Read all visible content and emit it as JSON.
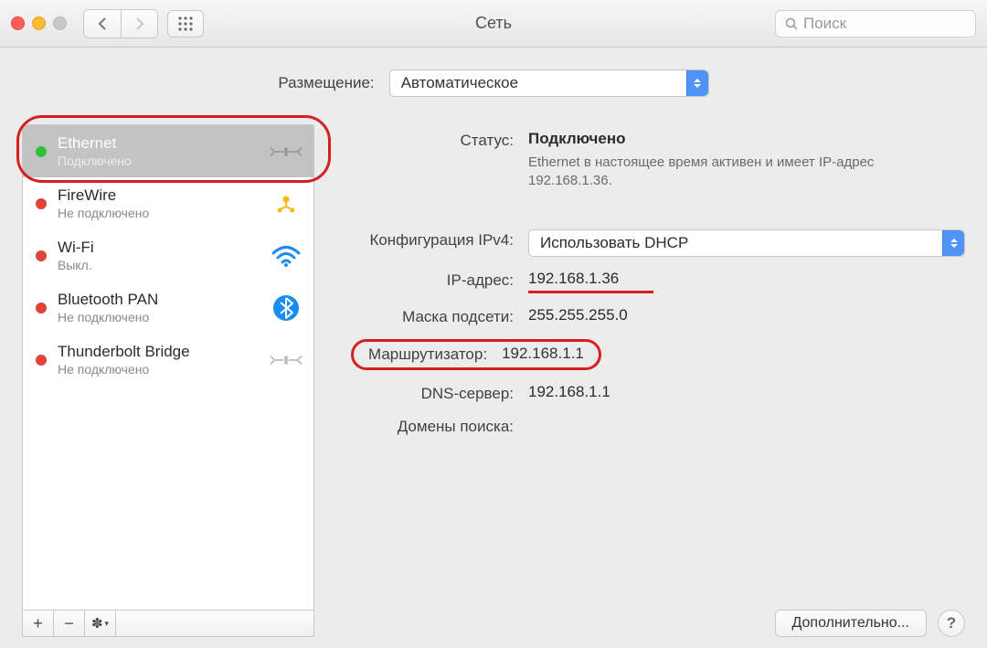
{
  "window": {
    "title": "Сеть"
  },
  "search": {
    "placeholder": "Поиск"
  },
  "location": {
    "label": "Размещение:",
    "value": "Автоматическое"
  },
  "connections": [
    {
      "name": "Ethernet",
      "status": "Подключено",
      "dot": "green",
      "icon": "ethernet",
      "selected": true
    },
    {
      "name": "FireWire",
      "status": "Не подключено",
      "dot": "red",
      "icon": "firewire"
    },
    {
      "name": "Wi-Fi",
      "status": "Выкл.",
      "dot": "red",
      "icon": "wifi"
    },
    {
      "name": "Bluetooth PAN",
      "status": "Не подключено",
      "dot": "red",
      "icon": "bluetooth"
    },
    {
      "name": "Thunderbolt Bridge",
      "status": "Не подключено",
      "dot": "red",
      "icon": "thunderbolt"
    }
  ],
  "detail": {
    "status_label": "Статус:",
    "status_value": "Подключено",
    "status_sub": "Ethernet в настоящее время активен и имеет IP-адрес 192.168.1.36.",
    "ipv4_label": "Конфигурация IPv4:",
    "ipv4_value": "Использовать DHCP",
    "ip_label": "IP-адрес:",
    "ip_value": "192.168.1.36",
    "mask_label": "Маска подсети:",
    "mask_value": "255.255.255.0",
    "router_label": "Маршрутизатор:",
    "router_value": "192.168.1.1",
    "dns_label": "DNS-сервер:",
    "dns_value": "192.168.1.1",
    "domains_label": "Домены поиска:"
  },
  "buttons": {
    "advanced": "Дополнительно...",
    "help": "?"
  }
}
